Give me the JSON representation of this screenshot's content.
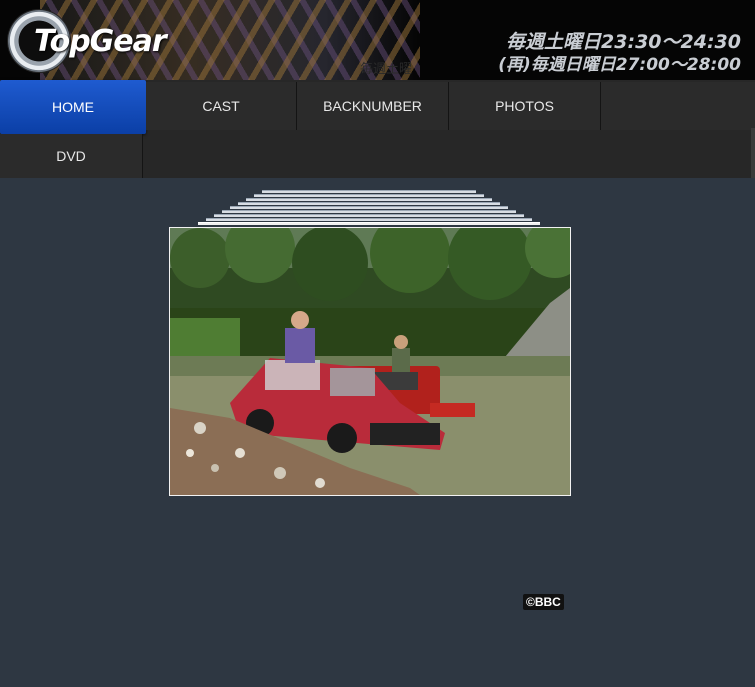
{
  "header": {
    "logo_text": "TopGear",
    "faint_title": "毎週土曜",
    "schedule_line1": "毎週土曜日23:30〜24:30",
    "schedule_line2": "(再)毎週日曜日27:00〜28:00"
  },
  "nav": {
    "items": [
      {
        "label": "HOME",
        "active": true
      },
      {
        "label": "CAST",
        "active": false
      },
      {
        "label": "BACKNUMBER",
        "active": false
      },
      {
        "label": "PHOTOS",
        "active": false
      },
      {
        "label": "DVD",
        "active": false
      }
    ]
  },
  "content": {
    "copyright": "©BBC"
  },
  "colors": {
    "background": "#2e3742",
    "nav": "#272727",
    "active_tab": "#1f5bd0"
  }
}
